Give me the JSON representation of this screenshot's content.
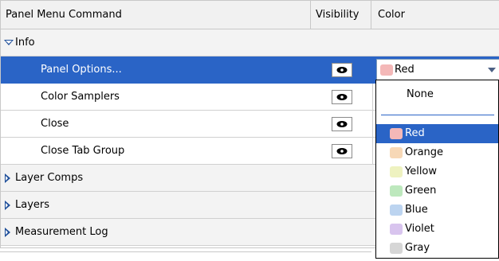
{
  "headers": {
    "command": "Panel Menu Command",
    "visibility": "Visibility",
    "color": "Color"
  },
  "groups": {
    "info": "Info",
    "layer_comps": "Layer Comps",
    "layers": "Layers",
    "measurement_log": "Measurement Log"
  },
  "items": [
    {
      "label": "Panel Options..."
    },
    {
      "label": "Color Samplers"
    },
    {
      "label": "Close"
    },
    {
      "label": "Close Tab Group"
    }
  ],
  "color_select": {
    "value": "Red",
    "swatch": "#f4b8b8"
  },
  "color_options": [
    {
      "label": "None",
      "swatch": ""
    },
    {
      "label": "Red",
      "swatch": "#f4b8b8"
    },
    {
      "label": "Orange",
      "swatch": "#f7d8b6"
    },
    {
      "label": "Yellow",
      "swatch": "#eef2c0"
    },
    {
      "label": "Green",
      "swatch": "#bde8bd"
    },
    {
      "label": "Blue",
      "swatch": "#bcd4f0"
    },
    {
      "label": "Violet",
      "swatch": "#d8c4ee"
    },
    {
      "label": "Gray",
      "swatch": "#d6d6d6"
    }
  ],
  "colors": {
    "selection": "#2a64c6",
    "tree_arrow": "#1e4f9a"
  }
}
